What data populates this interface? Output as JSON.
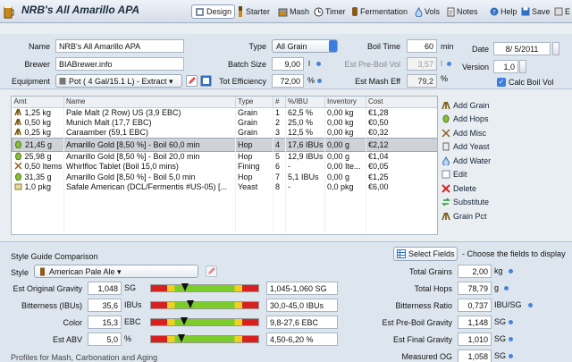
{
  "app": {
    "title": "NRB's All Amarillo APA"
  },
  "toolbar": {
    "design": "Design",
    "starter": "Starter",
    "mash": "Mash",
    "timer": "Timer",
    "fermentation": "Fermentation",
    "vols": "Vols",
    "notes": "Notes",
    "help": "Help",
    "save": "Save",
    "extra": "E"
  },
  "recipe": {
    "name_label": "Name",
    "name": "NRB's All Amarillo APA",
    "brewer_label": "Brewer",
    "brewer": "BIABrewer.info",
    "equipment_label": "Equipment",
    "equipment": "Pot ( 4 Gal/15.1 L) - Extract",
    "type_label": "Type",
    "type": "All Grain",
    "batch_label": "Batch Size",
    "batch": "9,00",
    "batch_unit": "l",
    "eff_label": "Tot Efficiency",
    "eff": "72,00",
    "eff_unit": "%",
    "boil_time_label": "Boil Time",
    "boil_time": "60",
    "boil_time_unit": "min",
    "preboil_label": "Est Pre-Boil Vol",
    "preboil": "3,57",
    "preboil_unit": "l",
    "masheff_label": "Est Mash Eff",
    "masheff": "79,2",
    "masheff_unit": "%",
    "date_label": "Date",
    "date": "8/ 5/2011",
    "version_label": "Version",
    "version": "1,0",
    "calc_label": "Calc Boil Vol"
  },
  "table": {
    "headers": [
      "Amt",
      "Name",
      "Type",
      "#",
      "%/IBU",
      "Inventory",
      "Cost"
    ],
    "rows": [
      {
        "amt": "1,25 kg",
        "name": "Pale Malt (2 Row) US (3,9 EBC)",
        "type": "Grain",
        "num": "1",
        "pct": "62,5 %",
        "inv": "0,00 kg",
        "cost": "€1,28",
        "icon": "grain-icon"
      },
      {
        "amt": "0,50 kg",
        "name": "Munich Malt (17,7 EBC)",
        "type": "Grain",
        "num": "2",
        "pct": "25,0 %",
        "inv": "0,00 kg",
        "cost": "€0,50",
        "icon": "grain-icon"
      },
      {
        "amt": "0,25 kg",
        "name": "Caraamber (59,1 EBC)",
        "type": "Grain",
        "num": "3",
        "pct": "12,5 %",
        "inv": "0,00 kg",
        "cost": "€0,32",
        "icon": "grain-icon"
      },
      {
        "amt": "21,45 g",
        "name": "Amarillo Gold [8,50 %] - Boil 60,0 min",
        "type": "Hop",
        "num": "4",
        "pct": "17,6 IBUs",
        "inv": "0,00 g",
        "cost": "€2,12",
        "icon": "hop-icon",
        "selected": true
      },
      {
        "amt": "25,98 g",
        "name": "Amarillo Gold [8,50 %] - Boil 20,0 min",
        "type": "Hop",
        "num": "5",
        "pct": "12,9 IBUs",
        "inv": "0,00 g",
        "cost": "€1,04",
        "icon": "hop-icon"
      },
      {
        "amt": "0,50 Items",
        "name": "Whirlfloc Tablet (Boil 15,0 mins)",
        "type": "Fining",
        "num": "6",
        "pct": "-",
        "inv": "0,00 Ite...",
        "cost": "€0,05",
        "icon": "misc-icon"
      },
      {
        "amt": "31,35 g",
        "name": "Amarillo Gold [8,50 %] - Boil 5,0 min",
        "type": "Hop",
        "num": "7",
        "pct": "5,1 IBUs",
        "inv": "0,00 g",
        "cost": "€1,25",
        "icon": "hop-icon"
      },
      {
        "amt": "1,0 pkg",
        "name": "Safale American (DCL/Fermentis #US-05) [...",
        "type": "Yeast",
        "num": "8",
        "pct": "-",
        "inv": "0,0 pkg",
        "cost": "€6,00",
        "icon": "yeast-icon"
      }
    ]
  },
  "actions": [
    "Add Grain",
    "Add Hops",
    "Add Misc",
    "Add Yeast",
    "Add Water",
    "Edit",
    "Delete",
    "Substitute",
    "Grain Pct"
  ],
  "style": {
    "section_title": "Style Guide Comparison",
    "style_label": "Style",
    "style_value": "American Pale Ale",
    "rows": [
      {
        "label": "Est Original Gravity",
        "value": "1,048",
        "unit": "SG",
        "range": "1,045-1,060 SG",
        "level": 0.32
      },
      {
        "label": "Bitterness (IBUs)",
        "value": "35,6",
        "unit": "IBUs",
        "range": "30,0-45,0 IBUs",
        "level": 0.37
      },
      {
        "label": "Color",
        "value": "15,3",
        "unit": "EBC",
        "range": "9,8-27,6 EBC",
        "level": 0.31
      },
      {
        "label": "Est ABV",
        "value": "5,0",
        "unit": "%",
        "range": "4,50-6,20 %",
        "level": 0.29
      }
    ],
    "profiles_label": "Profiles for Mash, Carbonation and Aging"
  },
  "fields": {
    "select_button": "Select Fields",
    "hint": "- Choose the fields to display",
    "rows": [
      {
        "label": "Total Grains",
        "value": "2,00",
        "unit": "kg"
      },
      {
        "label": "Total Hops",
        "value": "78,79",
        "unit": "g"
      },
      {
        "label": "Bitterness Ratio",
        "value": "0,737",
        "unit": "IBU/SG"
      },
      {
        "label": "Est Pre-Boil Gravity",
        "value": "1,148",
        "unit": "SG"
      },
      {
        "label": "Est Final Gravity",
        "value": "1,010",
        "unit": "SG"
      },
      {
        "label": "Measured OG",
        "value": "1,058",
        "unit": "SG"
      }
    ]
  },
  "colors": {
    "accent": "#4a84d8",
    "selected_row": "#cfd2d6",
    "panel": "#dde6ef"
  }
}
